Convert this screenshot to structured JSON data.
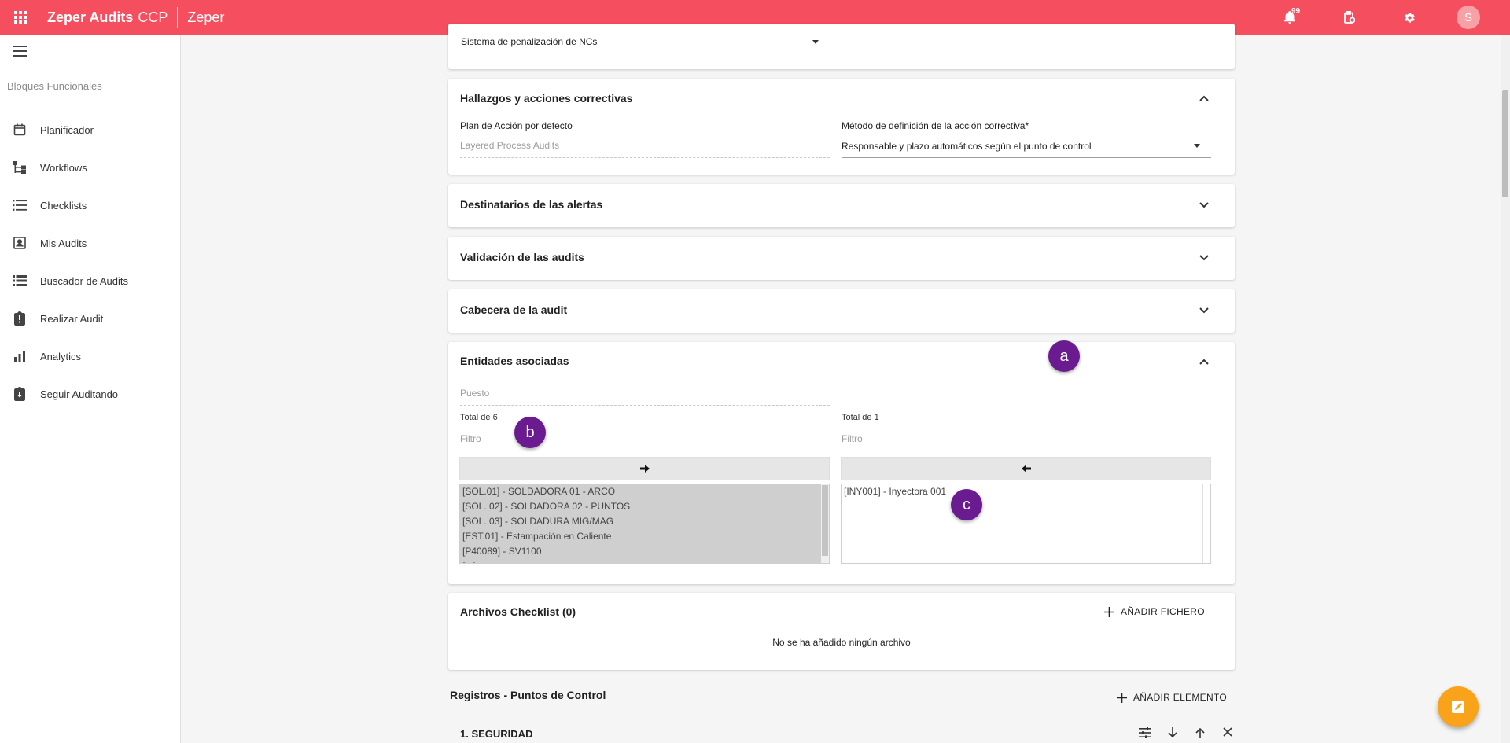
{
  "topbar": {
    "app_title": "Zeper Audits",
    "app_suffix": "CCP",
    "org": "Zeper",
    "notif_count": "99",
    "avatar_letter": "S"
  },
  "sidebar": {
    "heading": "Bloques Funcionales",
    "items": [
      {
        "label": "Planificador",
        "icon": "calendar-icon"
      },
      {
        "label": "Workflows",
        "icon": "workflow-icon"
      },
      {
        "label": "Checklists",
        "icon": "checklist-icon"
      },
      {
        "label": "Mis Audits",
        "icon": "person-card-icon"
      },
      {
        "label": "Buscador de Audits",
        "icon": "list-search-icon"
      },
      {
        "label": "Realizar Audit",
        "icon": "clipboard-alert-icon"
      },
      {
        "label": "Analytics",
        "icon": "bar-chart-icon"
      },
      {
        "label": "Seguir Auditando",
        "icon": "clipboard-download-icon"
      }
    ]
  },
  "penalty": {
    "value": "Sistema de penalización de NCs"
  },
  "findings": {
    "title": "Hallazgos y acciones correctivas",
    "plan_label": "Plan de Acción por defecto",
    "plan_value": "Layered Process Audits",
    "method_label": "Método de definición de la acción correctiva*",
    "method_value": "Responsable y plazo automáticos según el punto de control"
  },
  "alerts": {
    "title": "Destinatarios de las alertas"
  },
  "validation": {
    "title": "Validación de las audits"
  },
  "header_section": {
    "title": "Cabecera de la audit"
  },
  "entities": {
    "title": "Entidades asociadas",
    "puesto_placeholder": "Puesto",
    "left_total": "Total de 6",
    "right_total": "Total de 1",
    "left_filter": "Filtro",
    "right_filter": "Filtro",
    "available": [
      "[SOL.01] - SOLDADORA 01 - ARCO",
      "[SOL. 02] - SOLDADORA 02 - PUNTOS",
      "[SOL. 03] - SOLDADURA MIG/MAG",
      "[EST.01] - Estampación en Caliente",
      "[P40089] - SV1100",
      "[...]"
    ],
    "selected": [
      "[INY001] - Inyectora 001"
    ]
  },
  "markers": {
    "a": "a",
    "b": "b",
    "c": "c"
  },
  "files": {
    "title": "Archivos Checklist (0)",
    "add_label": "AÑADIR FICHERO",
    "empty": "No se ha añadido ningún archivo"
  },
  "records": {
    "title": "Registros - Puntos de Control",
    "add_label": "AÑADIR ELEMENTO",
    "first_row": "1. SEGURIDAD"
  },
  "colors": {
    "brand": "#f54e5e",
    "marker": "#6a1b8f",
    "fab": "#f9a31a"
  }
}
